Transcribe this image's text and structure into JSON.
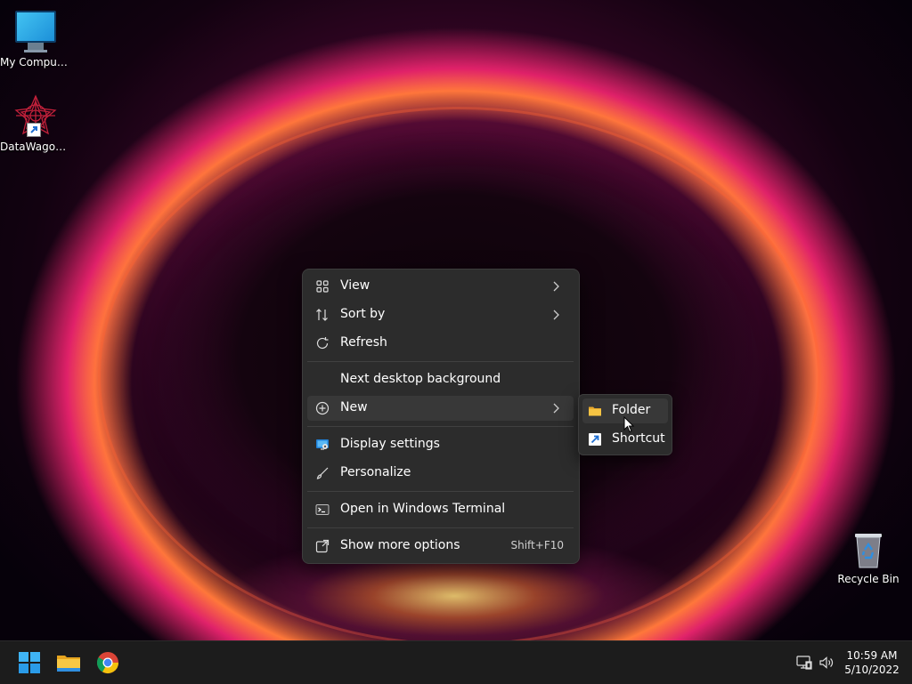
{
  "desktop": {
    "icons": [
      {
        "label": "My Computer"
      },
      {
        "label": "DataWagon..."
      },
      {
        "label": "Recycle Bin"
      }
    ]
  },
  "context_menu": {
    "items": {
      "view": "View",
      "sort_by": "Sort by",
      "refresh": "Refresh",
      "next_background": "Next desktop background",
      "new": "New",
      "display_settings": "Display settings",
      "personalize": "Personalize",
      "open_terminal": "Open in Windows Terminal",
      "show_more": "Show more options",
      "show_more_shortcut": "Shift+F10"
    }
  },
  "new_submenu": {
    "items": {
      "folder": "Folder",
      "shortcut": "Shortcut"
    }
  },
  "taskbar": {
    "clock_time": "10:59 AM",
    "clock_date": "5/10/2022"
  },
  "colors": {
    "menu_bg": "#2c2c2c",
    "hover_bg": "#383838",
    "accent_blue": "#3aa0f0",
    "folder_yellow": "#f5c343"
  }
}
